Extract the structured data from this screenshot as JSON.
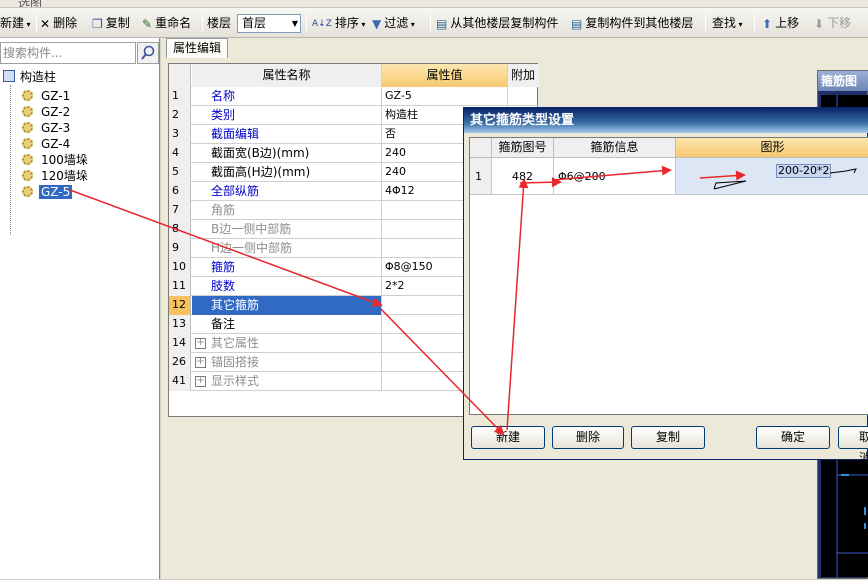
{
  "toolbar": {
    "top_clipped": [
      "选图",
      "",
      "",
      "",
      "",
      "",
      "",
      "",
      "",
      ""
    ],
    "new_label": "新建",
    "delete_label": "删除",
    "copy_label": "复制",
    "rename_label": "重命名",
    "floor_label": "楼层",
    "floor_value": "首层",
    "sort_label": "排序",
    "filter_label": "过滤",
    "copy_from_floor_label": "从其他楼层复制构件",
    "copy_to_floor_label": "复制构件到其他楼层",
    "find_label": "查找",
    "move_up_label": "上移",
    "move_down_label": "下移"
  },
  "left_panel": {
    "search_placeholder": "搜索构件...",
    "tree_root": "构造柱",
    "items": [
      "GZ-1",
      "GZ-2",
      "GZ-3",
      "GZ-4",
      "100墙垛",
      "120墙垛",
      "GZ-5"
    ],
    "selected_index": 6
  },
  "property_panel": {
    "tab_label": "属性编辑",
    "columns": [
      "属性名称",
      "属性值",
      "附加"
    ],
    "rows": [
      {
        "num": "1",
        "name": "名称",
        "value": "GZ-5"
      },
      {
        "num": "2",
        "name": "类别",
        "value": "构造柱"
      },
      {
        "num": "3",
        "name": "截面编辑",
        "value": "否"
      },
      {
        "num": "4",
        "name": "截面宽(B边)(mm)",
        "value": "240"
      },
      {
        "num": "5",
        "name": "截面高(H边)(mm)",
        "value": "240"
      },
      {
        "num": "6",
        "name": "全部纵筋",
        "value": "4Φ12"
      },
      {
        "num": "7",
        "name": "角筋",
        "value": ""
      },
      {
        "num": "8",
        "name": "B边一侧中部筋",
        "value": ""
      },
      {
        "num": "9",
        "name": "H边一侧中部筋",
        "value": ""
      },
      {
        "num": "10",
        "name": "箍筋",
        "value": "Φ8@150"
      },
      {
        "num": "11",
        "name": "肢数",
        "value": "2*2"
      },
      {
        "num": "12",
        "name": "其它箍筋",
        "value": ""
      },
      {
        "num": "13",
        "name": "备注",
        "value": ""
      },
      {
        "num": "14",
        "name": "其它属性",
        "value": ""
      },
      {
        "num": "26",
        "name": "锚固搭接",
        "value": ""
      },
      {
        "num": "41",
        "name": "显示样式",
        "value": ""
      }
    ],
    "selected_row": 11
  },
  "preview": {
    "title": "箍筋图"
  },
  "dialog": {
    "title": "其它箍筋类型设置",
    "columns": [
      "箍筋图号",
      "箍筋信息",
      "图形"
    ],
    "rows": [
      {
        "num": "1",
        "shape_no": "482",
        "info": "Φ6@200",
        "shape_label": "200-20*2"
      }
    ],
    "buttons": {
      "new": "新建",
      "delete": "删除",
      "copy": "复制",
      "ok": "确定",
      "cancel": "取消"
    }
  },
  "colors": {
    "selection": "#316ac5",
    "annotation_arrow": "#e8282b",
    "header_orange": "#f6c870"
  }
}
